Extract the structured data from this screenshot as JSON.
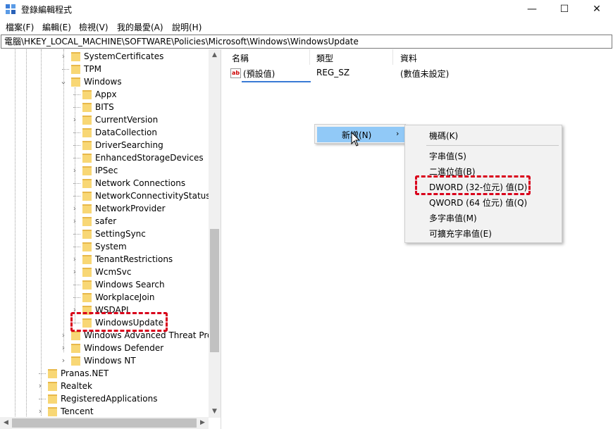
{
  "window": {
    "title": "登錄編輯程式",
    "minimize_glyph": "—",
    "maximize_glyph": "☐",
    "close_glyph": "✕"
  },
  "menu": [
    "檔案(F)",
    "編輯(E)",
    "檢視(V)",
    "我的最愛(A)",
    "說明(H)"
  ],
  "address": "電腦\\HKEY_LOCAL_MACHINE\\SOFTWARE\\Policies\\Microsoft\\Windows\\WindowsUpdate",
  "tree": {
    "items": [
      {
        "label": "SystemCertificates",
        "level": 1,
        "expandable": true
      },
      {
        "label": "TPM",
        "level": 1,
        "expandable": false
      },
      {
        "label": "Windows",
        "level": 1,
        "expandable": true,
        "expanded": true
      },
      {
        "label": "Appx",
        "level": 2,
        "expandable": false
      },
      {
        "label": "BITS",
        "level": 2,
        "expandable": false
      },
      {
        "label": "CurrentVersion",
        "level": 2,
        "expandable": true
      },
      {
        "label": "DataCollection",
        "level": 2,
        "expandable": false
      },
      {
        "label": "DriverSearching",
        "level": 2,
        "expandable": false
      },
      {
        "label": "EnhancedStorageDevices",
        "level": 2,
        "expandable": false
      },
      {
        "label": "IPSec",
        "level": 2,
        "expandable": true
      },
      {
        "label": "Network Connections",
        "level": 2,
        "expandable": false
      },
      {
        "label": "NetworkConnectivityStatusInd",
        "level": 2,
        "expandable": false
      },
      {
        "label": "NetworkProvider",
        "level": 2,
        "expandable": true
      },
      {
        "label": "safer",
        "level": 2,
        "expandable": true
      },
      {
        "label": "SettingSync",
        "level": 2,
        "expandable": false
      },
      {
        "label": "System",
        "level": 2,
        "expandable": false
      },
      {
        "label": "TenantRestrictions",
        "level": 2,
        "expandable": true
      },
      {
        "label": "WcmSvc",
        "level": 2,
        "expandable": true
      },
      {
        "label": "Windows Search",
        "level": 2,
        "expandable": false
      },
      {
        "label": "WorkplaceJoin",
        "level": 2,
        "expandable": false
      },
      {
        "label": "WSDAPI",
        "level": 2,
        "expandable": true
      },
      {
        "label": "WindowsUpdate",
        "level": 2,
        "expandable": false,
        "selected": true
      },
      {
        "label": "Windows Advanced Threat Protec",
        "level": 1,
        "expandable": true
      },
      {
        "label": "Windows Defender",
        "level": 1,
        "expandable": true
      },
      {
        "label": "Windows NT",
        "level": 1,
        "expandable": true
      },
      {
        "label": "Pranas.NET",
        "level": 0,
        "expandable": false
      },
      {
        "label": "Realtek",
        "level": 0,
        "expandable": true
      },
      {
        "label": "RegisteredApplications",
        "level": 0,
        "expandable": false
      },
      {
        "label": "Tencent",
        "level": 0,
        "expandable": true
      }
    ]
  },
  "list": {
    "columns": [
      "名稱",
      "類型",
      "資料"
    ],
    "rows": [
      {
        "name": "(預設值)",
        "type": "REG_SZ",
        "data": "(數值未設定)",
        "icon": "ab"
      }
    ]
  },
  "context_menu": {
    "parent_item": "新增(N)",
    "submenu_arrow": "›",
    "submenu": [
      "機碼(K)",
      "字串值(S)",
      "二進位值(B)",
      "DWORD (32-位元) 值(D)",
      "QWORD (64 位元) 值(Q)",
      "多字串值(M)",
      "可擴充字串值(E)"
    ]
  },
  "colors": {
    "highlight_dashed": "#d9001b",
    "menu_hover": "#91c9f7",
    "folder": "#f8d775"
  }
}
